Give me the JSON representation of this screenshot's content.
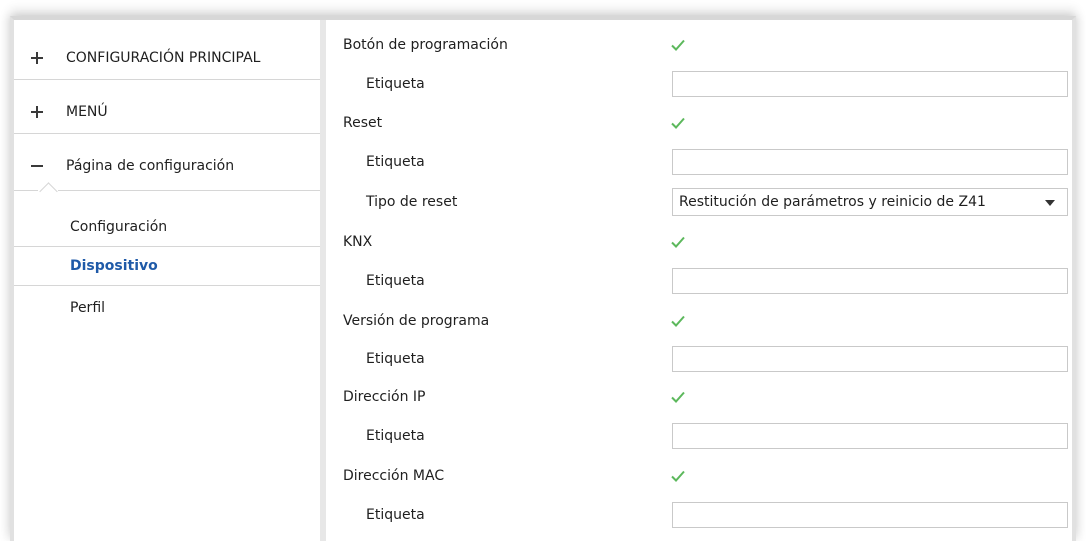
{
  "sidebar": {
    "items": [
      {
        "label": "CONFIGURACIÓN PRINCIPAL",
        "icon": "plus-icon"
      },
      {
        "label": "MENÚ",
        "icon": "plus-icon"
      },
      {
        "label": "Página de configuración",
        "icon": "minus-icon"
      }
    ],
    "subitems": [
      {
        "label": "Configuración"
      },
      {
        "label": "Dispositivo"
      },
      {
        "label": "Perfil"
      }
    ]
  },
  "params": {
    "boton_programacion": {
      "label": "Botón de programación",
      "checked": true
    },
    "boton_etiqueta": {
      "label": "Etiqueta",
      "value": ""
    },
    "reset": {
      "label": "Reset",
      "checked": true
    },
    "reset_etiqueta": {
      "label": "Etiqueta",
      "value": ""
    },
    "tipo_reset": {
      "label": "Tipo de reset",
      "value": "Restitución de parámetros y reinicio de Z41"
    },
    "knx": {
      "label": "KNX",
      "checked": true
    },
    "knx_etiqueta": {
      "label": "Etiqueta",
      "value": ""
    },
    "version": {
      "label": "Versión de programa",
      "checked": true
    },
    "version_etiqueta": {
      "label": "Etiqueta",
      "value": ""
    },
    "ip": {
      "label": "Dirección IP",
      "checked": true
    },
    "ip_etiqueta": {
      "label": "Etiqueta",
      "value": ""
    },
    "mac": {
      "label": "Dirección MAC",
      "checked": true
    },
    "mac_etiqueta": {
      "label": "Etiqueta",
      "value": ""
    }
  },
  "colors": {
    "active": "#1f5aa8",
    "check": "#4caf50"
  }
}
